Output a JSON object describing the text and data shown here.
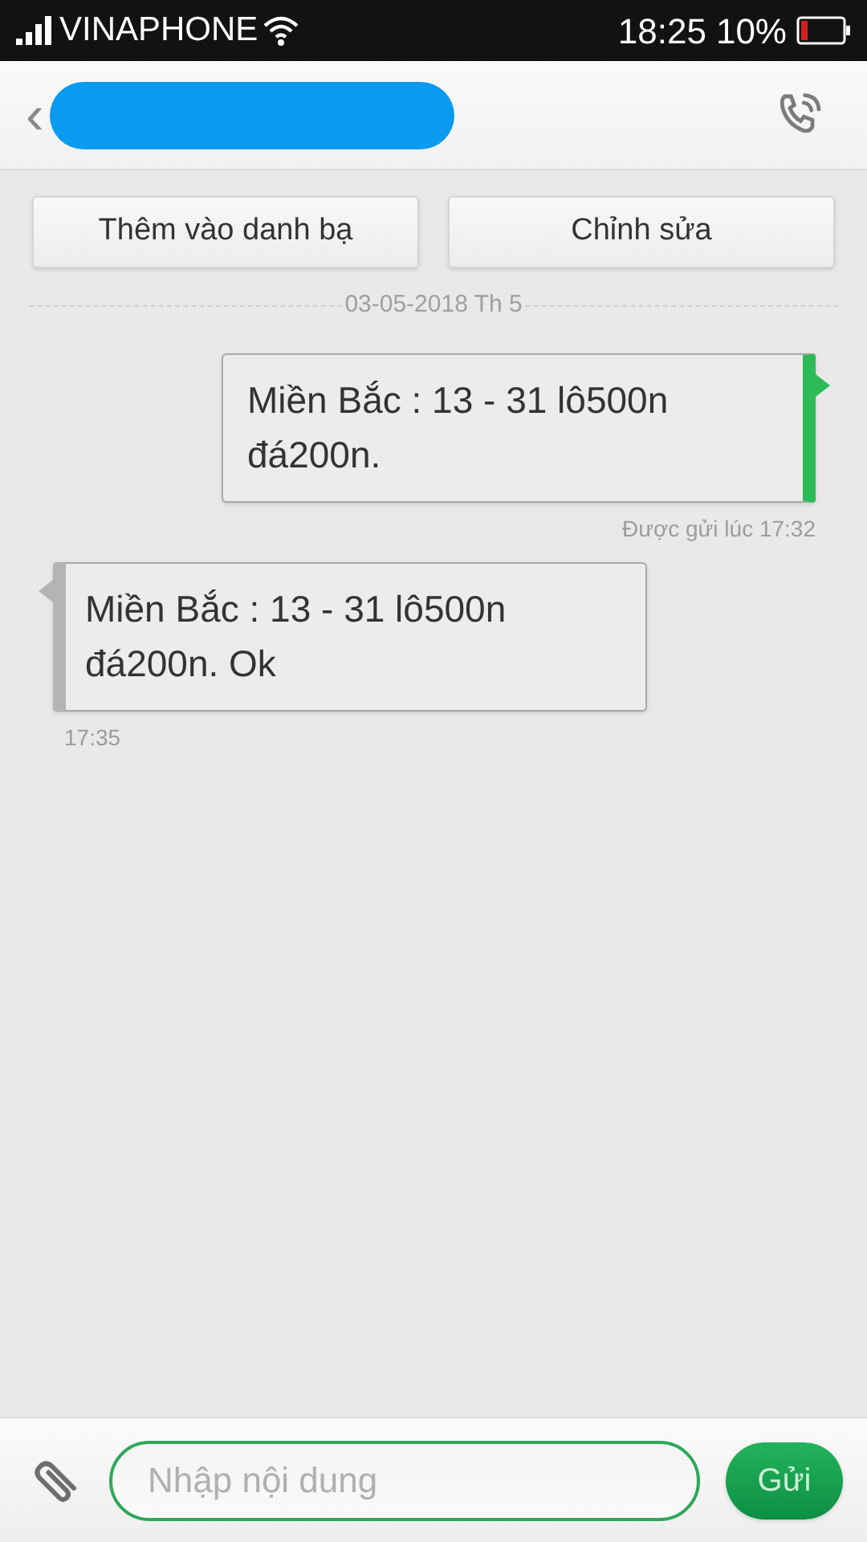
{
  "status_bar": {
    "carrier": "VINAPHONE",
    "time": "18:25",
    "battery": "10%"
  },
  "header": {
    "back": "‹"
  },
  "actions": [
    "Thêm vào danh bạ",
    "Chỉnh sửa"
  ],
  "date_separator": "03-05-2018 Th 5",
  "messages": [
    {
      "kind": "sent",
      "lines": [
        "Miền Bắc : 13 - 31 lô500n",
        "đá200n."
      ],
      "meta": "Được gửi lúc 17:32"
    },
    {
      "kind": "received",
      "lines": [
        "Miền Bắc : 13 - 31 lô500n",
        "đá200n. Ok"
      ],
      "meta": "17:35"
    }
  ],
  "composer": {
    "placeholder": "Nhập nội dung",
    "send": "Gửi"
  }
}
